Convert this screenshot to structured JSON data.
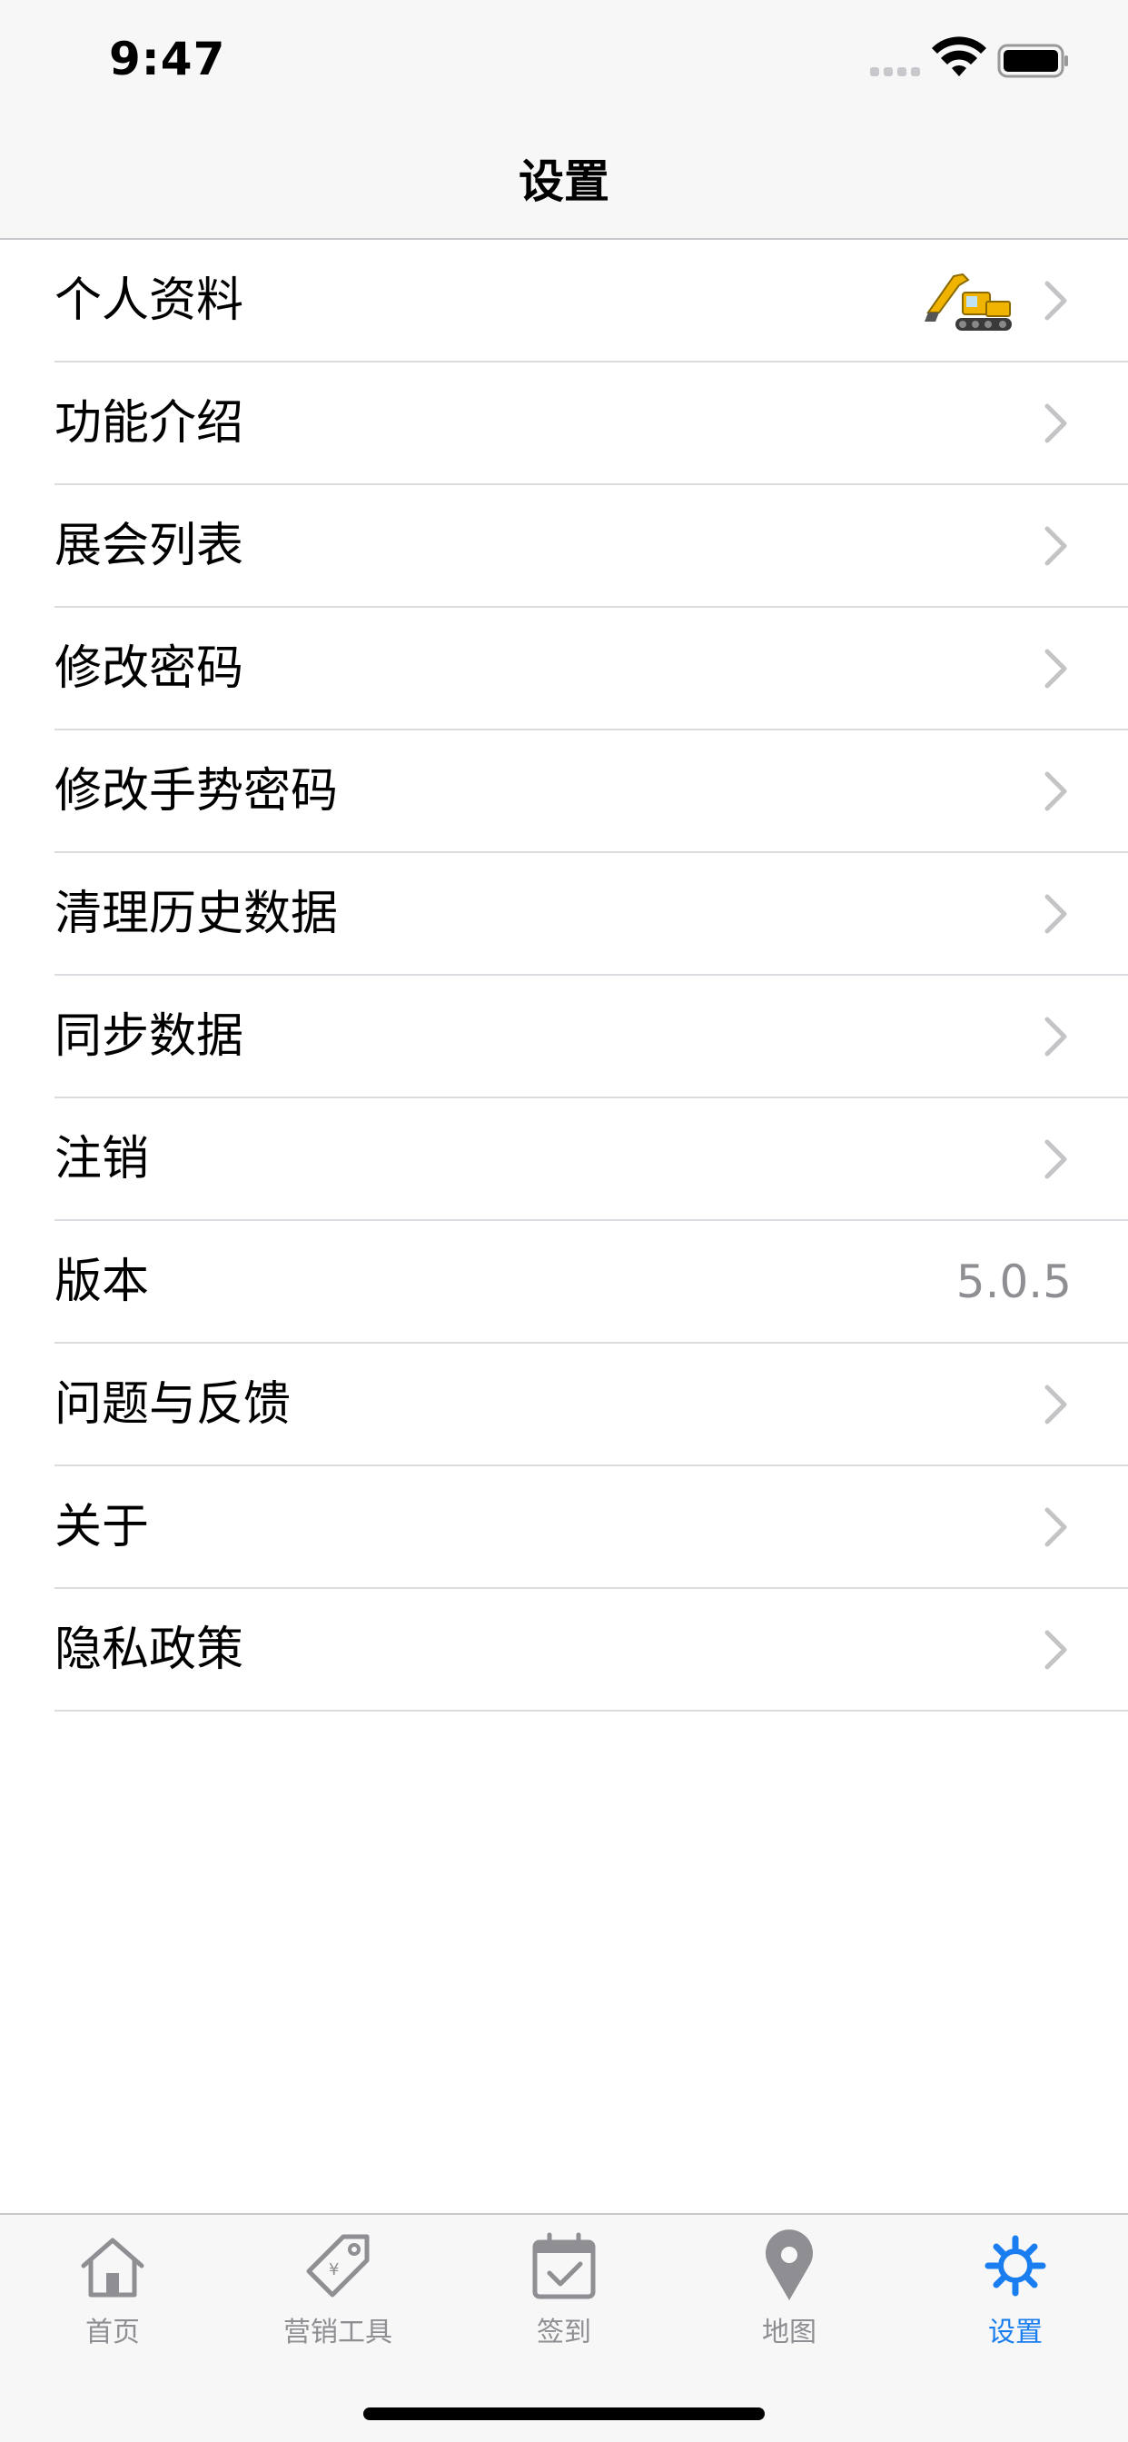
{
  "status_bar": {
    "time": "9:47"
  },
  "nav": {
    "title": "设置"
  },
  "settings": {
    "profile": "个人资料",
    "features": "功能介绍",
    "exhibitions": "展会列表",
    "change_password": "修改密码",
    "change_gesture_password": "修改手势密码",
    "clear_history": "清理历史数据",
    "sync_data": "同步数据",
    "logout": "注销",
    "version_label": "版本",
    "version_value": "5.0.5",
    "feedback": "问题与反馈",
    "about": "关于",
    "privacy": "隐私政策"
  },
  "tabbar": {
    "home": "首页",
    "marketing": "营销工具",
    "checkin": "签到",
    "map": "地图",
    "settings": "设置"
  },
  "colors": {
    "accent": "#1a7ef0",
    "inactive": "#8e8e93",
    "separator": "#dcdce0",
    "bar_bg": "#f7f7f7"
  }
}
